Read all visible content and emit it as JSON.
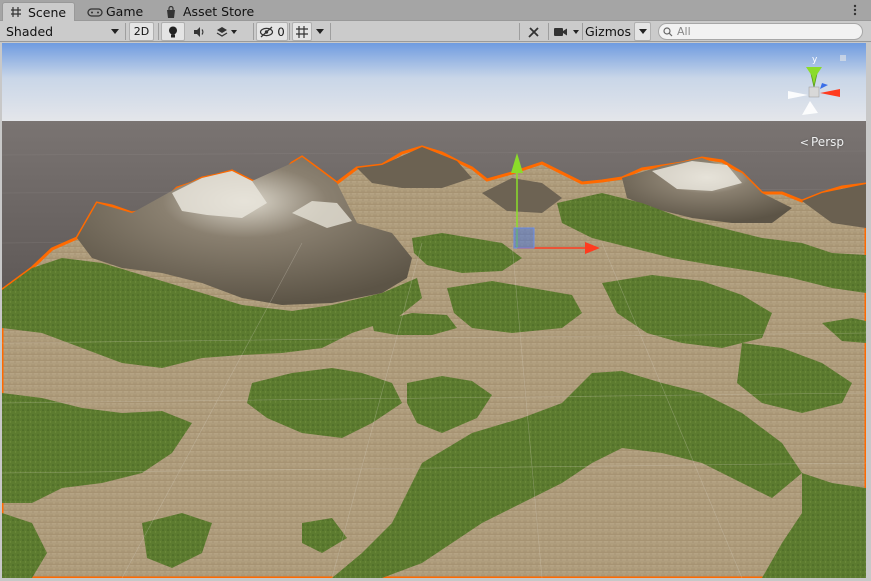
{
  "tabs": [
    {
      "label": "Scene",
      "icon": "grid-icon",
      "active": true
    },
    {
      "label": "Game",
      "icon": "gamepad-icon",
      "active": false
    },
    {
      "label": "Asset Store",
      "icon": "shopping-bag-icon",
      "active": false
    }
  ],
  "toolbar": {
    "draw_mode": "Shaded",
    "mode_2d": "2D",
    "hidden_count": "0",
    "gizmos": "Gizmos",
    "search_placeholder": "All"
  },
  "viewport": {
    "projection_label": "Persp",
    "selection_outline_color": "#ff6a00"
  },
  "colors": {
    "sky_top": "#7fa6d8",
    "sky_horizon": "#dfe3e8",
    "ground": "#6e6866",
    "sand": "#b9a585",
    "grass": "#5a7a2e",
    "rock": "#7a7060",
    "axis_x": "#ff3b1f",
    "axis_y": "#8bdc2a",
    "axis_z": "#3a6ee8"
  }
}
